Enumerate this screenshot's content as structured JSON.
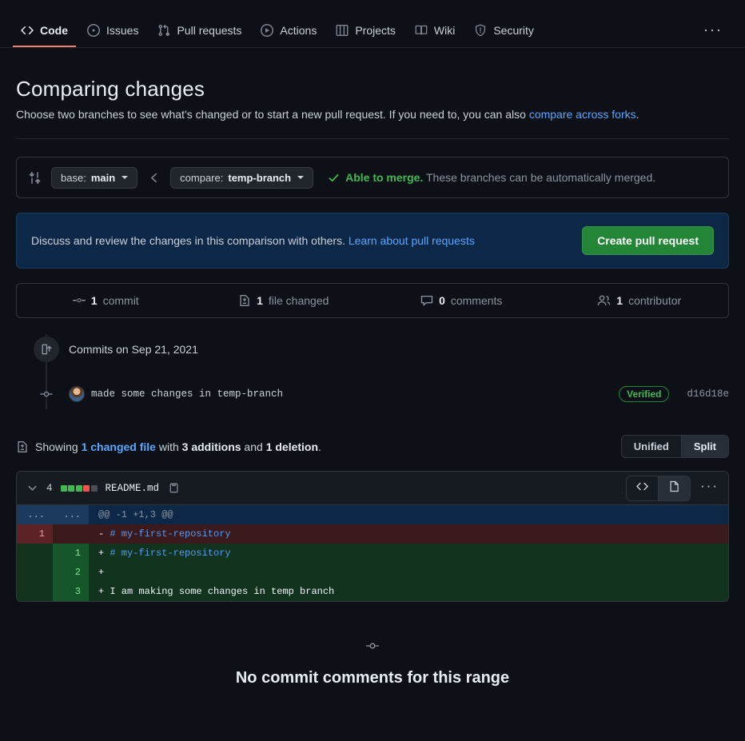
{
  "nav": {
    "items": [
      {
        "label": "Code",
        "icon": "code-icon",
        "active": true
      },
      {
        "label": "Issues",
        "icon": "issue-opened-icon",
        "active": false
      },
      {
        "label": "Pull requests",
        "icon": "git-pull-request-icon",
        "active": false
      },
      {
        "label": "Actions",
        "icon": "play-icon",
        "active": false
      },
      {
        "label": "Projects",
        "icon": "table-icon",
        "active": false
      },
      {
        "label": "Wiki",
        "icon": "book-icon",
        "active": false
      },
      {
        "label": "Security",
        "icon": "shield-icon",
        "active": false
      }
    ],
    "more_label": "···"
  },
  "header": {
    "title": "Comparing changes",
    "subtitle_before": "Choose two branches to see what’s changed or to start a new pull request. If you need to, you can also ",
    "subtitle_link": "compare across forks",
    "subtitle_after": "."
  },
  "branch_bar": {
    "compare_icon": "git-compare-icon",
    "base_prefix": "base: ",
    "base_branch": "main",
    "arrow_icon": "arrow-left-icon",
    "compare_prefix": "compare: ",
    "compare_branch": "temp-branch",
    "check_icon": "check-icon",
    "merge_status_bold": "Able to merge.",
    "merge_status_rest": " These branches can be automatically merged."
  },
  "discuss": {
    "text": "Discuss and review the changes in this comparison with others. ",
    "link": "Learn about pull requests",
    "button": "Create pull request"
  },
  "stats": [
    {
      "icon": "git-commit-icon",
      "value": "1",
      "label": "commit"
    },
    {
      "icon": "file-diff-icon",
      "value": "1",
      "label": "file changed"
    },
    {
      "icon": "comment-icon",
      "value": "0",
      "label": "comments"
    },
    {
      "icon": "people-icon",
      "value": "1",
      "label": "contributor"
    }
  ],
  "timeline": {
    "badge_icon": "git-commit-push-icon",
    "date_label": "Commits on Sep 21, 2021",
    "commit": {
      "node_icon": "git-commit-node-icon",
      "avatar": "user-avatar",
      "message": "made some changes in temp-branch",
      "verified_label": "Verified",
      "sha": "d16d18e"
    }
  },
  "showing": {
    "icon": "file-diff-icon",
    "prefix": "Showing ",
    "changed_file_link": "1 changed file",
    "mid": " with ",
    "additions": "3 additions",
    "and": " and ",
    "deletions": "1 deletion",
    "period": ".",
    "view_unified": "Unified",
    "view_split": "Split",
    "view_selected": "Split"
  },
  "file": {
    "chevron_icon": "chevron-down-icon",
    "change_count": "4",
    "stat_blocks": [
      "add",
      "add",
      "add",
      "del",
      "nul"
    ],
    "name": "README.md",
    "copy_icon": "copy-icon",
    "view_code_icon": "code-icon",
    "view_file_icon": "file-icon",
    "kebab_label": "···",
    "diff_lines": [
      {
        "type": "hunk",
        "old": "...",
        "new": "...",
        "marker": "",
        "text": "@@ -1 +1,3 @@",
        "md_head": ""
      },
      {
        "type": "del",
        "old": "1",
        "new": "",
        "marker": "- ",
        "text": "",
        "md_head": "# my-first-repository"
      },
      {
        "type": "add",
        "old": "",
        "new": "1",
        "marker": "+ ",
        "text": "",
        "md_head": "# my-first-repository"
      },
      {
        "type": "add",
        "old": "",
        "new": "2",
        "marker": "+ ",
        "text": "",
        "md_head": ""
      },
      {
        "type": "add",
        "old": "",
        "new": "3",
        "marker": "+ ",
        "text": "I am making some changes in temp branch",
        "md_head": ""
      }
    ]
  },
  "footer": {
    "node_icon": "git-commit-icon",
    "message": "No commit comments for this range"
  },
  "colors": {
    "accent_underline": "#f78166",
    "link": "#58a6ff",
    "success": "#3fb950",
    "button_green": "#238636",
    "banner_bg": "#0d2847",
    "page_bg": "#0d1117"
  }
}
